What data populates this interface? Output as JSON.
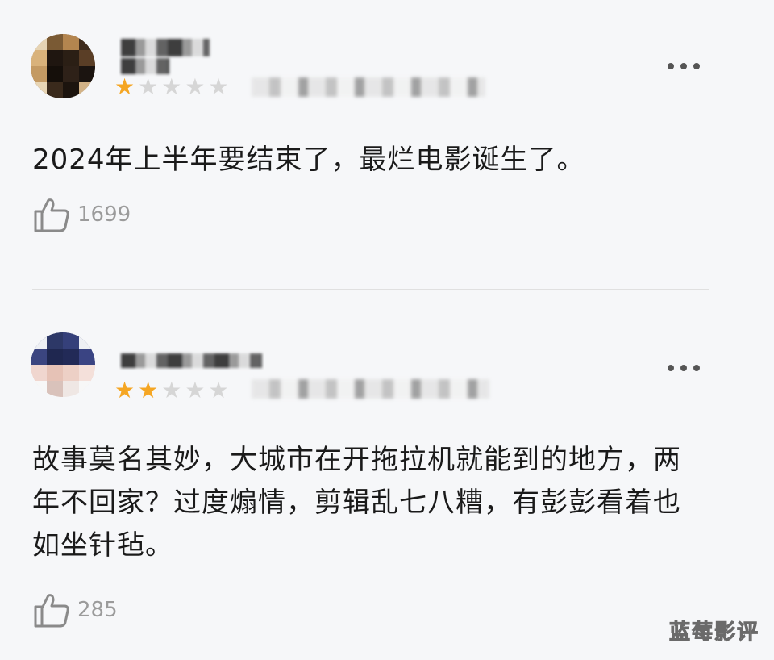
{
  "reviews": [
    {
      "rating": 1,
      "rating_max": 5,
      "comment": "2024年上半年要结束了，最烂电影诞生了。",
      "likes": "1699"
    },
    {
      "rating": 2,
      "rating_max": 5,
      "comment": "故事莫名其妙，大城市在开拖拉机就能到的地方，两年不回家？过度煽情，剪辑乱七八糟，有彭彭看着也如坐针毡。",
      "likes": "285"
    }
  ],
  "watermark": "蓝莓影评",
  "icons": {
    "like": "thumbs-up-icon",
    "more": "more-icon",
    "star": "star-icon"
  },
  "colors": {
    "star_on": "#f5a623",
    "star_off": "#d6d6d6",
    "like_text": "#9b9b9b"
  }
}
